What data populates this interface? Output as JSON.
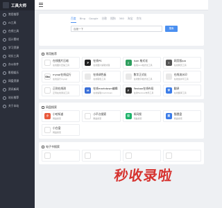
{
  "brand": {
    "title": "工具大师"
  },
  "sidebar": {
    "items": [
      {
        "label": "常用推荐"
      },
      {
        "label": "AI工具"
      },
      {
        "label": "在线工具"
      },
      {
        "label": "设计素材"
      },
      {
        "label": "学习资源"
      },
      {
        "label": "站长工具"
      },
      {
        "label": "办公软件"
      },
      {
        "label": "影视娱乐"
      },
      {
        "label": "网盘资源"
      },
      {
        "label": "资讯新闻"
      },
      {
        "label": "站长推荐"
      },
      {
        "label": "关于本站"
      }
    ]
  },
  "search": {
    "tabs": [
      "百度",
      "Bing",
      "Google",
      "谷歌",
      "搜狗",
      "360",
      "淘宝",
      "京东"
    ],
    "active_tab": "百度",
    "placeholder": "百度一下",
    "button_label": "搜索"
  },
  "sections": [
    {
      "title": "常用推荐",
      "cards": [
        {
          "title": "在线图片压缩",
          "desc": "在线图片压缩工具",
          "icon_color": "#ffffff",
          "icon_letter": ""
        },
        {
          "title": "在线PS",
          "desc": "在线图片编辑处理",
          "icon_color": "#222222",
          "icon_letter": "P"
        },
        {
          "title": "Json 格式化",
          "desc": "在线Json格式化工具",
          "icon_color": "#2e9e5e",
          "icon_letter": "J"
        },
        {
          "title": "网页版ipa",
          "desc": "在线网页工具",
          "icon_color": "#555555",
          "icon_letter": "i"
        },
        {
          "title": "mysql在线运行",
          "desc": "在线运行mysql",
          "icon_color": "#ffffff",
          "icon_letter": "Sto"
        },
        {
          "title": "在线调色板",
          "desc": "在线取色工具",
          "icon_color": "#e8e8e8",
          "icon_letter": ""
        },
        {
          "title": "数字正式化",
          "desc": "在线数字格式化工具",
          "icon_color": "#e8e8e8",
          "icon_letter": ""
        },
        {
          "title": "在线流水印",
          "desc": "在线加水印工具",
          "icon_color": "#e8e8e8",
          "icon_letter": ""
        },
        {
          "title": "正则在线测",
          "desc": "正则在线测试工具",
          "icon_color": "#ffffff",
          "icon_letter": ""
        },
        {
          "title": "在线markdown编辑器",
          "desc": "在线编辑markdown",
          "icon_color": "#3a6fd8",
          "icon_letter": "M"
        },
        {
          "title": "flexbox在线布局",
          "desc": "在线flexbox布局工具",
          "icon_color": "#333333",
          "icon_letter": "F"
        },
        {
          "title": "翻译",
          "desc": "在线翻译工具",
          "icon_color": "#3b7ce8",
          "icon_letter": "译"
        }
      ]
    },
    {
      "title": "网盘搜索",
      "cards": [
        {
          "title": "小哈知道",
          "desc": "网盘搜索",
          "icon_color": "#e85a3c",
          "icon_letter": "小"
        },
        {
          "title": "小不点搜索",
          "desc": "网盘搜索",
          "icon_color": "#ffffff",
          "icon_letter": ""
        },
        {
          "title": "如风搜",
          "desc": "网盘搜索",
          "icon_color": "#1db36a",
          "icon_letter": "如"
        },
        {
          "title": "猫狸盘",
          "desc": "网盘搜索",
          "icon_color": "#3b7ce8",
          "icon_letter": "猫"
        },
        {
          "title": "小白盘",
          "desc": "网盘搜索",
          "icon_color": "#ffffff",
          "icon_letter": ""
        }
      ]
    },
    {
      "title": "电子书搜索",
      "cards": [
        {
          "title": "",
          "desc": "",
          "icon_color": "#ffffff",
          "icon_letter": ""
        },
        {
          "title": "",
          "desc": "",
          "icon_color": "#ffffff",
          "icon_letter": ""
        },
        {
          "title": "",
          "desc": "",
          "icon_color": "#ffffff",
          "icon_letter": ""
        },
        {
          "title": "",
          "desc": "",
          "icon_color": "#ffffff",
          "icon_letter": ""
        }
      ]
    }
  ],
  "watermark": {
    "text": "秒收录啦"
  }
}
